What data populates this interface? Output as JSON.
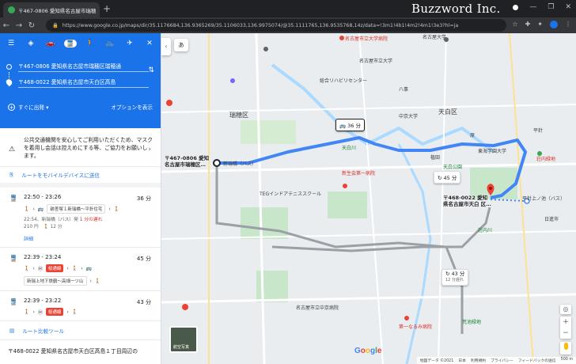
{
  "browser": {
    "tab_title": "〒467-0806 愛知県名古屋市瑞穂",
    "new_tab": "+",
    "brand": "Buzzword Inc.",
    "url": "https://www.google.co.jp/maps/dir/35.1176684,136.9365269/35.1106033,136.9975074/@35.1111765,136.9535768,14z/data=!3m1!4b1!4m2!4m1!3e3?hl=ja"
  },
  "panel": {
    "origin": "〒467-0806 愛知県名古屋市瑞穂区瑞穂通",
    "destination": "〒468-0022 愛知県名古屋市天白区高島",
    "leave_now": "すぐに出発",
    "options": "オプションを表示",
    "notice": "公共交通機関を安心してご利用いただくため、マスクを着用し会話は控えめにする等、ご協力をお願いします。",
    "send_to_device": "ルートをモバイルデバイスに送信",
    "routes": [
      {
        "time": "22:50 - 23:26",
        "duration": "36 分",
        "chip": "跡差塚１新瑞橋〜平針住宅",
        "detail1": "22:54、新瑞橋（バス）発",
        "late": "1 分の遅れ",
        "fare": "210 円",
        "walk": "12 分",
        "detail_link": "詳細"
      },
      {
        "time": "22:39 - 23:24",
        "duration": "45 分",
        "chip": "桜通線",
        "line2": "新瑞上地下鉄鶴〜高畑一ツ山"
      },
      {
        "time": "22:39 - 23:22",
        "duration": "43 分",
        "chip": "桜通線"
      }
    ],
    "compare": "ルート比較ツール",
    "dest_full": "〒468-0022 愛知県名古屋市天白区高島１丁目周辺の"
  },
  "map": {
    "bubbles": [
      "36 分",
      "45 分",
      "43 分"
    ],
    "bubble3_sub": "12 分遅れ",
    "origin_label": [
      "〒467-0806 愛知",
      "名古屋市瑞穂区…"
    ],
    "dest_label": [
      "〒468-0022 愛知",
      "県名古屋市天白 区…"
    ],
    "stop1": "新瑞橋（バス）",
    "stop2": "平針上ノ池（バス）",
    "ward1": "瑞穂区",
    "ward2": "天白区",
    "labels": {
      "a": "名古屋市立大学病院",
      "b": "名古屋市立大学",
      "c": "名古屋大学",
      "d": "八事",
      "e": "中京大学",
      "f": "天白川",
      "g": "新生会第一病院",
      "h": "植田",
      "i": "平針",
      "j": "原",
      "k": "天白公園",
      "l": "東海学園大学",
      "m": "荘内緑地",
      "n": "名古屋市立中京病院",
      "o": "第一なるみ病院",
      "p": "荒池緑地",
      "q": "総合リハビリセンター",
      "r": "TEGインドアテニススクール",
      "s": "荘内川",
      "t": "日進市"
    },
    "sat": "航空写真",
    "footer": [
      "地図データ ©2021",
      "日本",
      "利用規約",
      "プライバシー",
      "フィードバックの送信",
      "500 m"
    ]
  },
  "colors": {
    "accent": "#1a73e8",
    "route": "#4285f4",
    "water": "#aadaff",
    "park": "#c5e8c5",
    "red": "#ea4335"
  }
}
